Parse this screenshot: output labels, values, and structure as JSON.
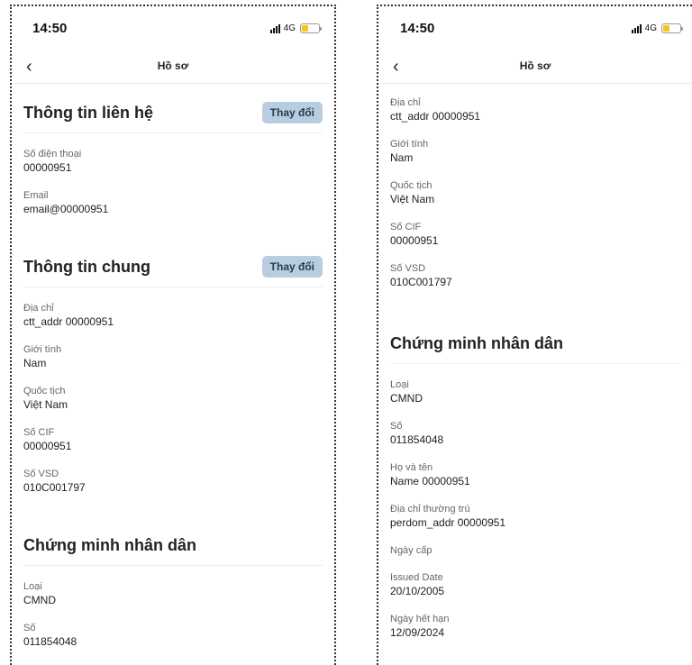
{
  "status_bar": {
    "time": "14:50",
    "network": "4G"
  },
  "header": {
    "title": "Hồ sơ"
  },
  "left_screen": {
    "contact": {
      "title": "Thông tin liên hệ",
      "edit_label": "Thay đổi",
      "fields": [
        {
          "label": "Số điện thoại",
          "value": "00000951"
        },
        {
          "label": "Email",
          "value": "email@00000951"
        }
      ]
    },
    "general": {
      "title": "Thông tin chung",
      "edit_label": "Thay đổi",
      "fields": [
        {
          "label": "Địa chỉ",
          "value": "ctt_addr 00000951"
        },
        {
          "label": "Giới tính",
          "value": "Nam"
        },
        {
          "label": "Quốc tịch",
          "value": "Việt Nam"
        },
        {
          "label": "Số CIF",
          "value": "00000951"
        },
        {
          "label": "Số VSD",
          "value": "010C001797"
        }
      ]
    },
    "id_card": {
      "title": "Chứng minh nhân dân",
      "fields": [
        {
          "label": "Loại",
          "value": "CMND"
        },
        {
          "label": "Số",
          "value": "011854048"
        }
      ]
    }
  },
  "right_screen": {
    "general_fields": [
      {
        "label": "Địa chỉ",
        "value": "ctt_addr 00000951"
      },
      {
        "label": "Giới tính",
        "value": "Nam"
      },
      {
        "label": "Quốc tịch",
        "value": "Việt Nam"
      },
      {
        "label": "Số CIF",
        "value": "00000951"
      },
      {
        "label": "Số VSD",
        "value": "010C001797"
      }
    ],
    "id_card": {
      "title": "Chứng minh nhân dân",
      "fields": [
        {
          "label": "Loại",
          "value": "CMND"
        },
        {
          "label": "Số",
          "value": "011854048"
        },
        {
          "label": "Họ và tên",
          "value": "Name 00000951"
        },
        {
          "label": "Địa chỉ thường trú",
          "value": "perdom_addr 00000951"
        },
        {
          "label": "Ngày cấp",
          "value": ""
        },
        {
          "label": "Issued Date",
          "value": "20/10/2005"
        },
        {
          "label": "Ngày hết hạn",
          "value": "12/09/2024"
        }
      ]
    }
  }
}
